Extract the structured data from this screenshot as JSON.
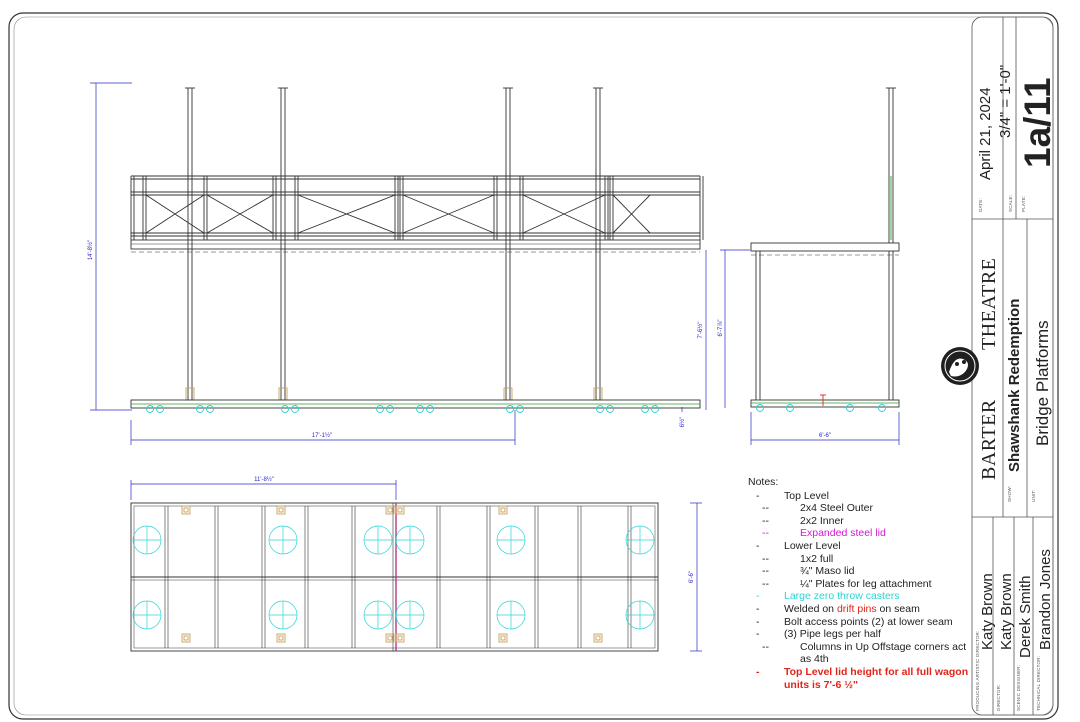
{
  "drawing": {
    "elevation_dims": {
      "overall_height": "14'-8½\"",
      "platform_height": "7'-6½\"",
      "side_height": "6'-7⅞\"",
      "deck_thickness": "6½\"",
      "front_width": "17'-1½\"",
      "side_width": "6'-6\""
    },
    "plan_dims": {
      "half_length": "11'-8½\"",
      "depth": "6'-6\""
    }
  },
  "notes": {
    "title": "Notes:",
    "items": [
      {
        "level": 0,
        "dash": "-",
        "text": "Top Level"
      },
      {
        "level": 1,
        "dash": "--",
        "text": "2x4 Steel Outer"
      },
      {
        "level": 1,
        "dash": "--",
        "text": "2x2 Inner"
      },
      {
        "level": 1,
        "dash": "--",
        "text": "Expanded steel lid",
        "color": "magenta"
      },
      {
        "level": 0,
        "dash": "-",
        "text": "Lower Level"
      },
      {
        "level": 1,
        "dash": "--",
        "text": "1x2 full"
      },
      {
        "level": 1,
        "dash": "--",
        "text": "¾\" Maso lid"
      },
      {
        "level": 1,
        "dash": "--",
        "text": "¼\" Plates for leg attachment"
      },
      {
        "level": 0,
        "dash": "-",
        "text": "Large zero throw casters",
        "color": "cyan"
      },
      {
        "level": 0,
        "dash": "-",
        "pre": "Welded on ",
        "hl": "drift pins",
        "post": " on seam"
      },
      {
        "level": 0,
        "dash": "-",
        "text": "Bolt access points (2) at lower seam"
      },
      {
        "level": 0,
        "dash": "-",
        "text": "(3) Pipe legs per half"
      },
      {
        "level": 1,
        "dash": "--",
        "text": "Columns in Up Offstage corners act as 4th"
      },
      {
        "level": 0,
        "dash": "-",
        "text": "Top Level lid height for all full wagon units is 7'-6 ½\"",
        "color": "bold-red"
      }
    ]
  },
  "title_block": {
    "date_label": "DATE:",
    "date": "April 21, 2024",
    "scale_label": "SCALE:",
    "scale": "3/4\" = 1'-0\"",
    "plate_label": "PLATE:",
    "plate": "1a/11",
    "theatre_word1": "BARTER",
    "theatre_word2": "THEATRE",
    "show_label": "SHOW:",
    "show": "Shawshank Redemption",
    "unit_label": "UNIT:",
    "unit": "Bridge Platforms",
    "people": [
      {
        "role": "PRODUCING ARTISTIC DIRECTOR:",
        "name": "Katy Brown"
      },
      {
        "role": "DIRECTOR:",
        "name": "Katy Brown"
      },
      {
        "role": "SCENIC DESIGNER:",
        "name": "Derek Smith"
      },
      {
        "role": "TECHNICAL DIRECTOR:",
        "name": "Brandon Jones"
      }
    ]
  },
  "colors": {
    "line": "#333333",
    "dim": "#2a2ac8",
    "caster": "#2ad4d4",
    "lid": "#d21ad2",
    "leg_plate": "#c8a060",
    "seam": "#b03a8a",
    "green": "#2aa02a"
  }
}
